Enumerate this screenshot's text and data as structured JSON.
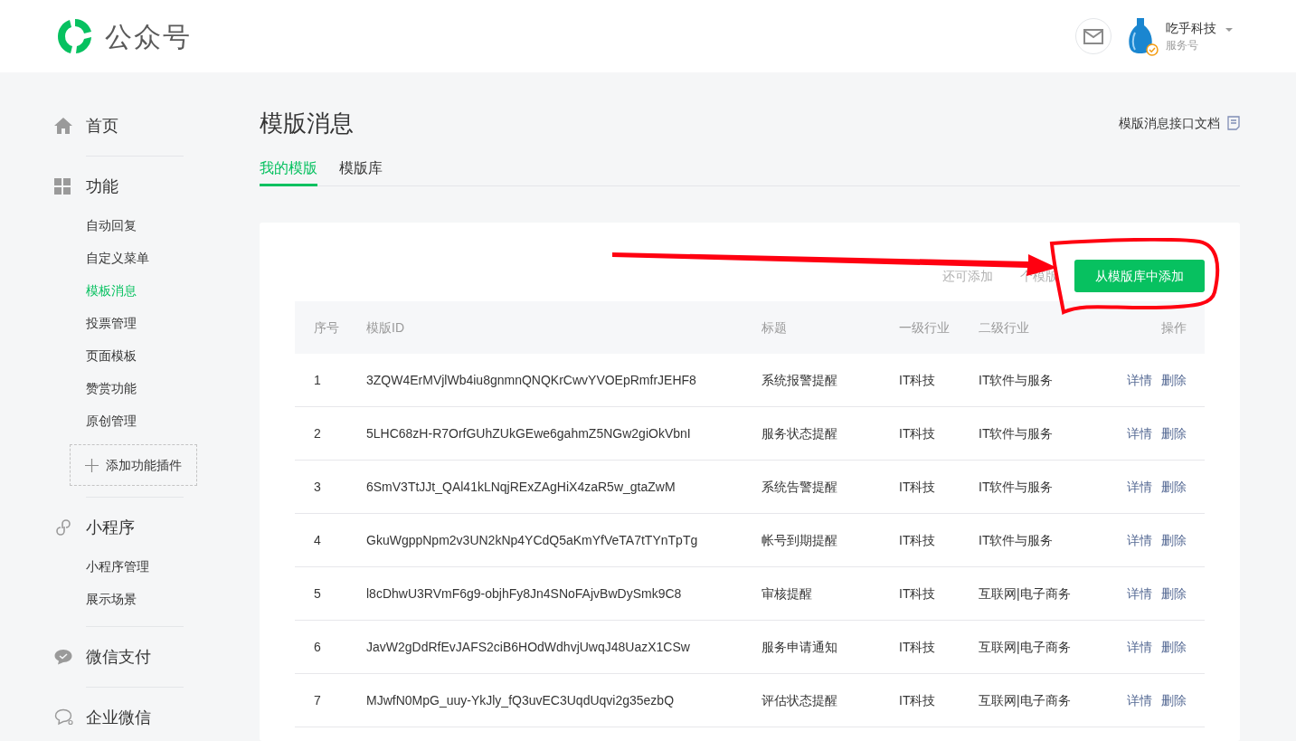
{
  "header": {
    "logo_text": "公众号",
    "account": {
      "name": "吃乎科技",
      "type": "服务号"
    }
  },
  "sidebar": [
    {
      "label": "首页"
    },
    {
      "label": "功能",
      "children": [
        {
          "label": "自动回复",
          "selected": false
        },
        {
          "label": "自定义菜单",
          "selected": false
        },
        {
          "label": "模板消息",
          "selected": true
        },
        {
          "label": "投票管理",
          "selected": false
        },
        {
          "label": "页面模板",
          "selected": false
        },
        {
          "label": "赞赏功能",
          "selected": false
        },
        {
          "label": "原创管理",
          "selected": false
        }
      ],
      "add_button": "添加功能插件"
    },
    {
      "label": "小程序",
      "children": [
        {
          "label": "小程序管理",
          "selected": false
        },
        {
          "label": "展示场景",
          "selected": false
        }
      ]
    },
    {
      "label": "微信支付"
    },
    {
      "label": "企业微信"
    }
  ],
  "page": {
    "title": "模版消息",
    "doc_link": "模版消息接口文档",
    "tabs": [
      {
        "label": "我的模版",
        "selected": true
      },
      {
        "label": "模版库",
        "selected": false
      }
    ],
    "hint_before": "还可添加",
    "hint_after": "个模版",
    "add_button": "从模版库中添加",
    "table": {
      "columns": [
        "序号",
        "模版ID",
        "标题",
        "一级行业",
        "二级行业",
        "操作"
      ],
      "rows": [
        {
          "index": "1",
          "id": "3ZQW4ErMVjlWb4iu8gnmnQNQKrCwvYVOEpRmfrJEHF8",
          "title": "系统报警提醒",
          "industry_1": "IT科技",
          "industry_2": "IT软件与服务",
          "actions": [
            "详情",
            "删除"
          ]
        },
        {
          "index": "2",
          "id": "5LHC68zH-R7OrfGUhZUkGEwe6gahmZ5NGw2giOkVbnI",
          "title": "服务状态提醒",
          "industry_1": "IT科技",
          "industry_2": "IT软件与服务",
          "actions": [
            "详情",
            "删除"
          ]
        },
        {
          "index": "3",
          "id": "6SmV3TtJJt_QAl41kLNqjRExZAgHiX4zaR5w_gtaZwM",
          "title": "系统告警提醒",
          "industry_1": "IT科技",
          "industry_2": "IT软件与服务",
          "actions": [
            "详情",
            "删除"
          ]
        },
        {
          "index": "4",
          "id": "GkuWgppNpm2v3UN2kNp4YCdQ5aKmYfVeTA7tTYnTpTg",
          "title": "帐号到期提醒",
          "industry_1": "IT科技",
          "industry_2": "IT软件与服务",
          "actions": [
            "详情",
            "删除"
          ]
        },
        {
          "index": "5",
          "id": "l8cDhwU3RVmF6g9-objhFy8Jn4SNoFAjvBwDySmk9C8",
          "title": "审核提醒",
          "industry_1": "IT科技",
          "industry_2": "互联网|电子商务",
          "actions": [
            "详情",
            "删除"
          ]
        },
        {
          "index": "6",
          "id": "JavW2gDdRfEvJAFS2ciB6HOdWdhvjUwqJ48UazX1CSw",
          "title": "服务申请通知",
          "industry_1": "IT科技",
          "industry_2": "互联网|电子商务",
          "actions": [
            "详情",
            "删除"
          ]
        },
        {
          "index": "7",
          "id": "MJwfN0MpG_uuy-YkJly_fQ3uvEC3UqdUqvi2g35ezbQ",
          "title": "评估状态提醒",
          "industry_1": "IT科技",
          "industry_2": "互联网|电子商务",
          "actions": [
            "详情",
            "删除"
          ]
        }
      ]
    }
  }
}
